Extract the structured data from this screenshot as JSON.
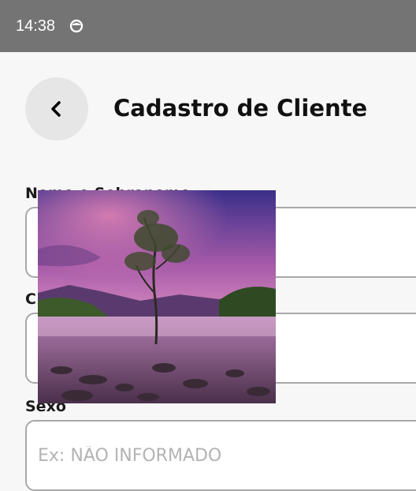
{
  "status_bar": {
    "time": "14:38"
  },
  "header": {
    "title": "Cadastro de Cliente"
  },
  "form": {
    "name_label": "Nome e Sobrenome",
    "second_label": "C",
    "sex_label": "Sexo",
    "sex_placeholder": "Ex: NÃO INFORMADO"
  },
  "colors": {
    "status_bar": "#747474",
    "background": "#f7f7f7",
    "back_button": "#e6e6e6"
  },
  "icons": {
    "status": "notification-icon",
    "back": "chevron-left-icon",
    "photo": "landscape-photo"
  }
}
